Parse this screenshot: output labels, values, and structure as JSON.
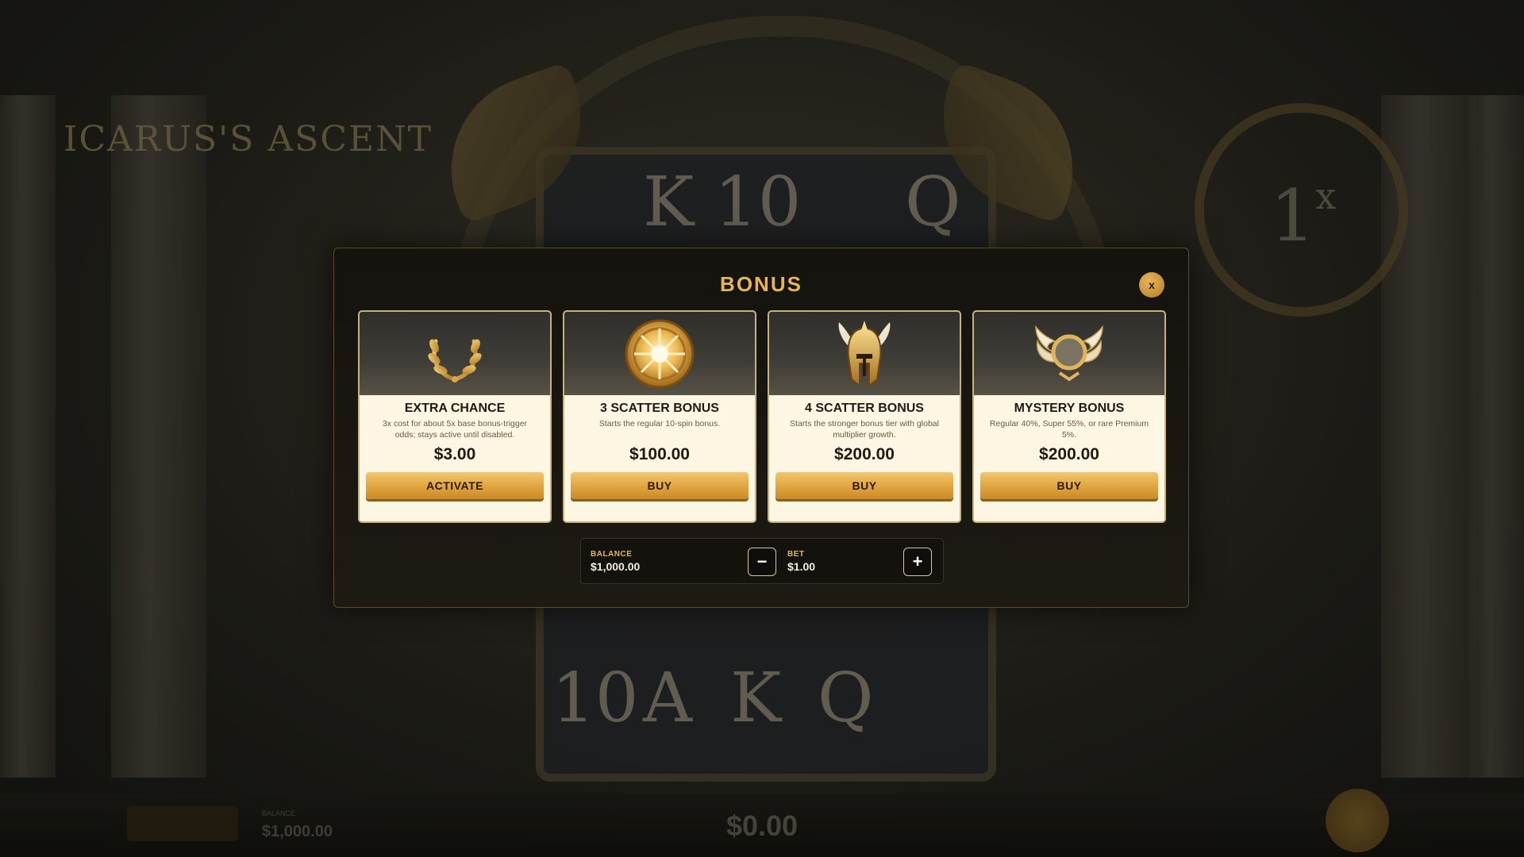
{
  "background": {
    "logo": "ICARUS'S ASCENT",
    "multiplier": "1",
    "multiplier_suffix": "x",
    "symbols_top": [
      "K",
      "10",
      "Q"
    ],
    "symbols_bottom": [
      "10",
      "A",
      "K",
      "Q"
    ],
    "hud_balance_label": "BALANCE",
    "hud_balance": "$1,000.00",
    "hud_win": "$0.00"
  },
  "modal": {
    "title": "BONUS",
    "close_label": "x",
    "cards": [
      {
        "name": "EXTRA CHANCE",
        "description": "3x cost for about 5x base bonus-trigger odds; stays active until disabled.",
        "price": "$3.00",
        "button": "ACTIVATE",
        "icon": "laurel-wreath-icon"
      },
      {
        "name": "3 SCATTER BONUS",
        "description": "Starts the regular 10-spin bonus.",
        "price": "$100.00",
        "button": "BUY",
        "icon": "sun-medallion-icon"
      },
      {
        "name": "4 SCATTER BONUS",
        "description": "Starts the stronger bonus tier with global multiplier growth.",
        "price": "$200.00",
        "button": "BUY",
        "icon": "winged-helmet-icon"
      },
      {
        "name": "MYSTERY BONUS",
        "description": "Regular 40%, Super 55%, or rare Premium 5%.",
        "price": "$200.00",
        "button": "BUY",
        "icon": "winged-orb-icon"
      }
    ],
    "footer": {
      "balance_label": "BALANCE",
      "balance_value": "$1,000.00",
      "bet_label": "BET",
      "bet_value": "$1.00",
      "minus_label": "−",
      "plus_label": "+"
    }
  },
  "colors": {
    "accent_gold": "#e6b45a",
    "card_bg": "#fdf6e3",
    "modal_bg": "#17150f"
  }
}
